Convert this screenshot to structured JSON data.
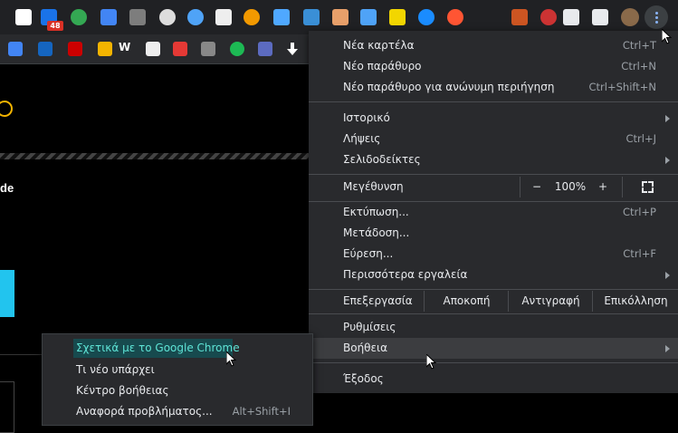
{
  "toolbar": {
    "extensions": [
      {
        "icon": "r-app-icon",
        "color": "#ffffff"
      },
      {
        "icon": "notifier-icon",
        "color": "#1a73e8"
      },
      {
        "icon": "d-app-icon",
        "color": "#34a853"
      },
      {
        "icon": "google-translate-icon",
        "color": "#4285f4"
      },
      {
        "icon": "ublock-icon",
        "color": "#7d7d7d"
      },
      {
        "icon": "s-app-icon",
        "color": "#dddddd"
      },
      {
        "icon": "a-circle-icon",
        "color": "#4fa3f7"
      },
      {
        "icon": "window-icon",
        "color": "#eeeeee"
      },
      {
        "icon": "globe-icon",
        "color": "#f29900"
      },
      {
        "icon": "m-app-icon",
        "color": "#4fa8ff"
      },
      {
        "icon": "send-arrow-icon",
        "color": "#3a8fd6"
      },
      {
        "icon": "box-face-icon",
        "color": "#e8a06a"
      },
      {
        "icon": "network-icon",
        "color": "#4fa3f7"
      },
      {
        "icon": "yellow-square-icon",
        "color": "#f2d600"
      },
      {
        "icon": "shazam-icon",
        "color": "#1a8cff"
      },
      {
        "icon": "b-circle-icon",
        "color": "#ff5533"
      },
      {
        "icon": "tv-icon",
        "color": "#cc5522"
      },
      {
        "icon": "red-circle-icon",
        "color": "#cc3333"
      },
      {
        "icon": "puzzle-icon",
        "color": "#e8eaed"
      },
      {
        "icon": "playlist-icon",
        "color": "#e8eaed"
      },
      {
        "icon": "avatar",
        "color": "#8a6a4a"
      }
    ],
    "badge_count": "48",
    "bookmarks": [
      {
        "icon": "google-translate-icon",
        "color": "#4285f4"
      },
      {
        "icon": "m-news-icon",
        "color": "#1565c0"
      },
      {
        "icon": "u-red-icon",
        "color": "#cc0000"
      },
      {
        "icon": "doc-icon",
        "color": "#f4b400"
      },
      {
        "icon": "w-icon",
        "color": "#ffffff"
      },
      {
        "icon": "chess-icon",
        "color": "#eeeeee"
      },
      {
        "icon": "euro-icon",
        "color": "#e53935"
      },
      {
        "icon": "gear-square-icon",
        "color": "#888888"
      },
      {
        "icon": "spotify-icon",
        "color": "#1db954"
      },
      {
        "icon": "chevron-logo-icon",
        "color": "#5c6bc0"
      },
      {
        "icon": "download-arrow-icon",
        "color": "#ffffff"
      }
    ],
    "bookmark_w_label": "W"
  },
  "page": {
    "visible_word": "de"
  },
  "menu": {
    "group1": [
      {
        "label": "Νέα καρτέλα",
        "shortcut": "Ctrl+T"
      },
      {
        "label": "Νέο παράθυρο",
        "shortcut": "Ctrl+N"
      },
      {
        "label": "Νέο παράθυρο για ανώνυμη περιήγηση",
        "shortcut": "Ctrl+Shift+N"
      }
    ],
    "group2": [
      {
        "label": "Ιστορικό",
        "shortcut": ""
      },
      {
        "label": "Λήψεις",
        "shortcut": "Ctrl+J"
      },
      {
        "label": "Σελιδοδείκτες",
        "shortcut": ""
      }
    ],
    "zoom": {
      "label": "Μεγέθυνση",
      "minus": "−",
      "value": "100%",
      "plus": "+"
    },
    "group3": [
      {
        "label": "Εκτύπωση...",
        "shortcut": "Ctrl+P"
      },
      {
        "label": "Μετάδοση...",
        "shortcut": ""
      },
      {
        "label": "Εύρεση...",
        "shortcut": "Ctrl+F"
      },
      {
        "label": "Περισσότερα εργαλεία",
        "shortcut": ""
      }
    ],
    "edit": {
      "label": "Επεξεργασία",
      "cut": "Αποκοπή",
      "copy": "Αντιγραφή",
      "paste": "Επικόλληση"
    },
    "settings": "Ρυθμίσεις",
    "help": "Βοήθεια",
    "exit": "Έξοδος"
  },
  "submenu": {
    "items": [
      {
        "label": "Σχετικά με το Google Chrome",
        "shortcut": ""
      },
      {
        "label": "Τι νέο υπάρχει",
        "shortcut": ""
      },
      {
        "label": "Κέντρο βοήθειας",
        "shortcut": ""
      },
      {
        "label": "Αναφορά προβλήματος...",
        "shortcut": "Alt+Shift+I"
      }
    ]
  },
  "colors": {
    "menu_bg": "#292a2d",
    "highlight": "#3c3d40",
    "accent_text": "#5ee4d6",
    "accent_bg": "#174a4e",
    "page_cyan": "#22c4ee"
  }
}
